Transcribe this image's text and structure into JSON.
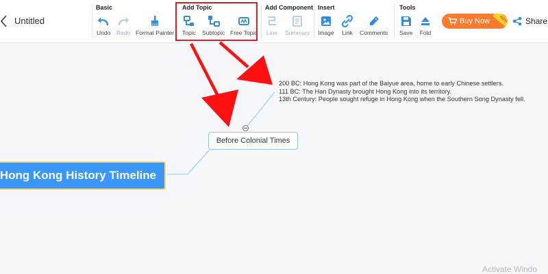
{
  "document": {
    "title": "Untitled"
  },
  "toolbar": {
    "groups": {
      "basic": "Basic",
      "add_topic": "Add Topic",
      "add_component": "Add Component",
      "insert": "Insert",
      "tools": "Tools"
    },
    "tools": {
      "undo": "Undo",
      "redo": "Redo",
      "format_painter": "Format Painter",
      "topic": "Topic",
      "subtopic": "Subtopic",
      "free_topic": "Free Topic",
      "line": "Line",
      "summary": "Summary",
      "image": "Image",
      "link": "Link",
      "comments": "Comments",
      "save": "Save",
      "fold": "Fold"
    },
    "buy_now": {
      "label": "Buy Now",
      "badge": "-60%"
    },
    "share": "Share",
    "icon_color": "#2f8de4",
    "disabled_icon_color": "#b8cde6"
  },
  "mindmap": {
    "root": "Hong Kong History Timeline",
    "topic": "Before Colonial Times",
    "notes": [
      "200 BC: Hong Kong was part of the Baiyue area, home to early Chinese settlers.",
      "111 BC: The Han Dynasty brought Hong Kong into its territory.",
      "13th Century: People sought refuge in Hong Kong when the Southern Song Dynasty fell."
    ]
  },
  "watermark": "Activate Windo",
  "colors": {
    "root_fill": "#3b97f7",
    "root_border": "#ffd86a",
    "connector": "#8ec8f0",
    "highlight": "#e02020",
    "buy_button": "#ff7a2d",
    "canvas_bg": "#f5f7fb"
  }
}
